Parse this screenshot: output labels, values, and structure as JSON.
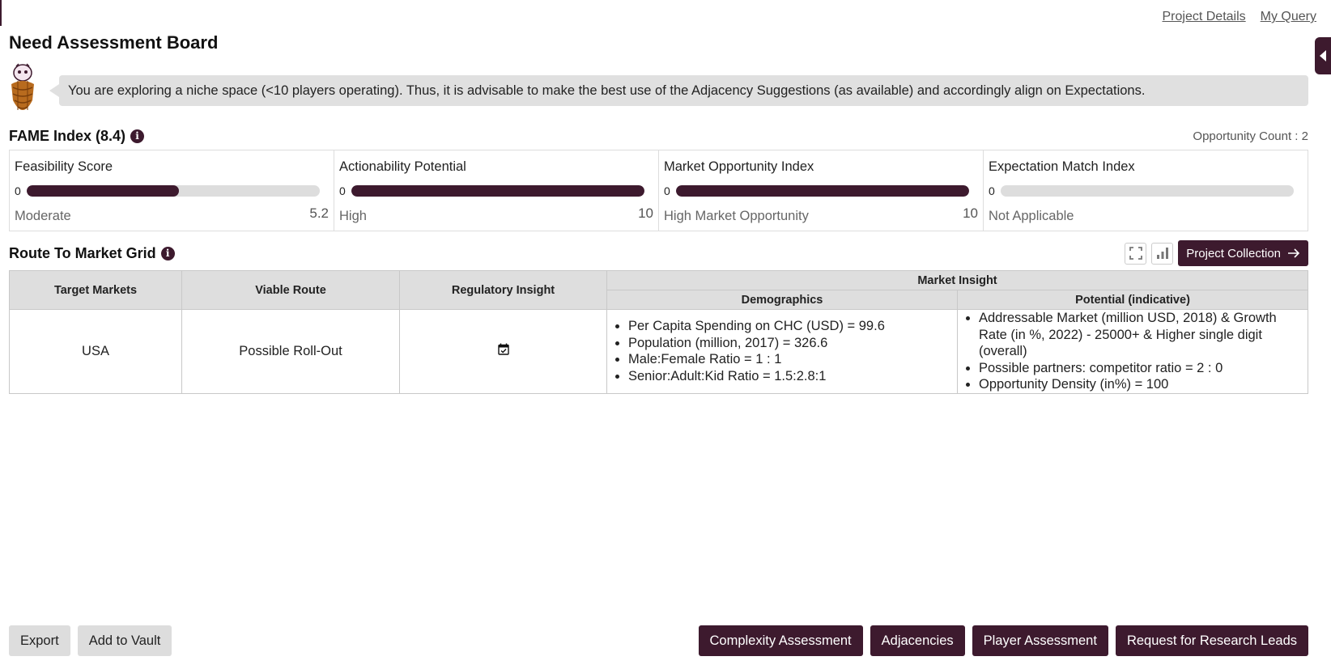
{
  "header": {
    "links": [
      "Project Details",
      "My Query"
    ],
    "title": "Need Assessment Board"
  },
  "notice": {
    "text": "You are exploring a niche space (<10 players operating). Thus, it is advisable to make the best use of the Adjacency Suggestions (as available) and accordingly align on Expectations."
  },
  "fame": {
    "title": "FAME Index (8.4)",
    "opportunity_count": "Opportunity Count : 2",
    "cards": [
      {
        "title": "Feasibility Score",
        "min": "0",
        "level": "Moderate",
        "value": "5.2",
        "fill": 0.52
      },
      {
        "title": "Actionability Potential",
        "min": "0",
        "level": "High",
        "value": "10",
        "fill": 1.0
      },
      {
        "title": "Market Opportunity Index",
        "min": "0",
        "level": "High Market Opportunity",
        "value": "10",
        "fill": 1.0
      },
      {
        "title": "Expectation Match Index",
        "min": "0",
        "level": "Not Applicable",
        "value": "",
        "fill": 0.0
      }
    ]
  },
  "route": {
    "title": "Route To Market Grid",
    "collection_button": "Project Collection",
    "columns": {
      "target_markets": "Target Markets",
      "viable_route": "Viable Route",
      "regulatory_insight": "Regulatory Insight",
      "market_insight": "Market Insight",
      "demographics": "Demographics",
      "potential": "Potential (indicative)"
    },
    "rows": [
      {
        "target_market": "USA",
        "viable_route": "Possible Roll-Out",
        "demographics": [
          "Per Capita Spending on CHC (USD) = 99.6",
          "Population (million, 2017) = 326.6",
          "Male:Female Ratio = 1 : 1",
          "Senior:Adult:Kid Ratio = 1.5:2.8:1"
        ],
        "potential": [
          "Addressable Market (million USD, 2018) & Growth Rate (in %, 2022) - 25000+ & Higher single digit (overall)",
          "Possible partners: competitor ratio = 2 : 0",
          "Opportunity Density (in%) = 100"
        ]
      }
    ]
  },
  "footer": {
    "left_buttons": [
      "Export",
      "Add to Vault"
    ],
    "right_buttons": [
      "Complexity Assessment",
      "Adjacencies",
      "Player Assessment",
      "Request for Research Leads"
    ]
  },
  "colors": {
    "brand": "#3d1a2e",
    "track": "#dddddd",
    "notice_bg": "#e0e0e0",
    "header_bg": "#dedede"
  },
  "icons": {
    "info": "info-icon",
    "expand": "fullscreen-icon",
    "chart": "bar-chart-icon",
    "arrow": "arrow-right-icon",
    "calendar": "calendar-check-icon",
    "mascot": "pinecone-mascot-icon",
    "toggle": "caret-left-icon"
  }
}
